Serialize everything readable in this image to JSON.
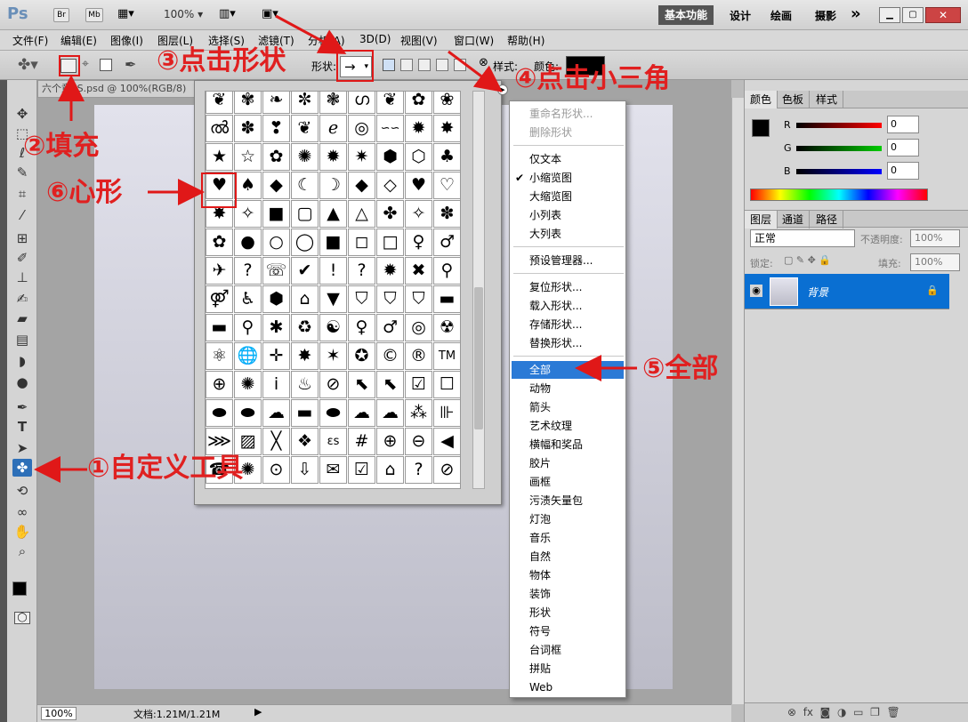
{
  "titlebar": {
    "app_logo": "Ps",
    "br": "Br",
    "mb": "Mb",
    "zoom": "100%",
    "workspaces": [
      "基本功能",
      "设计",
      "绘画",
      "摄影"
    ],
    "more": "»"
  },
  "menu": [
    "文件(F)",
    "编辑(E)",
    "图像(I)",
    "图层(L)",
    "选择(S)",
    "滤镜(T)",
    "分析(A)",
    "3D(D)",
    "视图(V)",
    "窗口(W)",
    "帮助(H)"
  ],
  "options_bar": {
    "shape_label": "形状:",
    "shape_value": "→",
    "style_label": "样式:",
    "color_label": "颜色:"
  },
  "document": {
    "tab_title": "六个童PS.psd @ 100%(RGB/8)",
    "zoom": "100%",
    "doc_info": "文档:1.21M/1.21M"
  },
  "color_panel": {
    "tabs": [
      "颜色",
      "色板",
      "样式"
    ],
    "channels": [
      {
        "label": "R",
        "value": "0"
      },
      {
        "label": "G",
        "value": "0"
      },
      {
        "label": "B",
        "value": "0"
      }
    ]
  },
  "layers_panel": {
    "tabs": [
      "图层",
      "通道",
      "路径"
    ],
    "blend_mode": "正常",
    "opacity_label": "不透明度:",
    "opacity_value": "100%",
    "lock_label": "锁定:",
    "fill_label": "填充:",
    "fill_value": "100%",
    "layer_name": "背景"
  },
  "shape_cells": [
    "❦",
    "✾",
    "❧",
    "✼",
    "❃",
    "ഗ",
    "❦",
    "✿",
    "❀",
    "ൽ",
    "✽",
    "❣",
    "❦",
    "ℯ",
    "◎",
    "∽∽",
    "✹",
    "✸",
    "★",
    "☆",
    "✿",
    "✺",
    "✹",
    "✷",
    "⬢",
    "⬡",
    "♣",
    "♥",
    "♠",
    "◆",
    "☾",
    "☽",
    "◆",
    "◇",
    "♥",
    "♡",
    "✸",
    "✧",
    "■",
    "▢",
    "▲",
    "△",
    "✤",
    "✧",
    "✽",
    "✿",
    "●",
    "○",
    "◯",
    "■",
    "◻",
    "□",
    "♀",
    "♂",
    "✈",
    "?",
    "☏",
    "✔",
    "!",
    "?",
    "✹",
    "✖",
    "⚲",
    "⚤",
    "♿",
    "⬢",
    "⌂",
    "▼",
    "⛉",
    "⛉",
    "⛉",
    "▬",
    "▬",
    "⚲",
    "✱",
    "♻",
    "☯",
    "♀",
    "♂",
    "◎",
    "☢",
    "⚛",
    "🌐",
    "✛",
    "✸",
    "✶",
    "✪",
    "©",
    "®",
    "TM",
    "⊕",
    "✺",
    "ⅰ",
    "♨",
    "⊘",
    "⬉",
    "⬉",
    "☑",
    "☐",
    "⬬",
    "⬬",
    "☁",
    "▬",
    "⬬",
    "☁",
    "☁",
    "⁂",
    "⊪",
    "⋙",
    "▨",
    "╳",
    "❖",
    "ɛs",
    "#",
    "⊕",
    "⊖",
    "◀",
    "☎",
    "✺",
    "⊙",
    "⇩",
    "✉",
    "☑",
    "⌂",
    "?",
    "⊘"
  ],
  "flyout": {
    "group1": [
      "重命名形状...",
      "删除形状"
    ],
    "group2": [
      "仅文本",
      "小缩览图",
      "大缩览图",
      "小列表",
      "大列表"
    ],
    "group3": [
      "预设管理器..."
    ],
    "group4": [
      "复位形状...",
      "载入形状...",
      "存储形状...",
      "替换形状..."
    ],
    "group5": [
      "全部",
      "动物",
      "箭头",
      "艺术纹理",
      "横幅和奖品",
      "胶片",
      "画框",
      "污渍矢量包",
      "灯泡",
      "音乐",
      "自然",
      "物体",
      "装饰",
      "形状",
      "符号",
      "台词框",
      "拼贴",
      "Web"
    ],
    "checked": "小缩览图",
    "selected": "全部"
  },
  "annotations": [
    "①自定义工具",
    "②填充",
    "③点击形状",
    "④点击小三角",
    "⑤全部",
    "⑥心形"
  ],
  "colors": {
    "annotation_red": "#e01818",
    "menu_highlight": "#2b7ad6",
    "layer_selected": "#0a6fd2"
  }
}
